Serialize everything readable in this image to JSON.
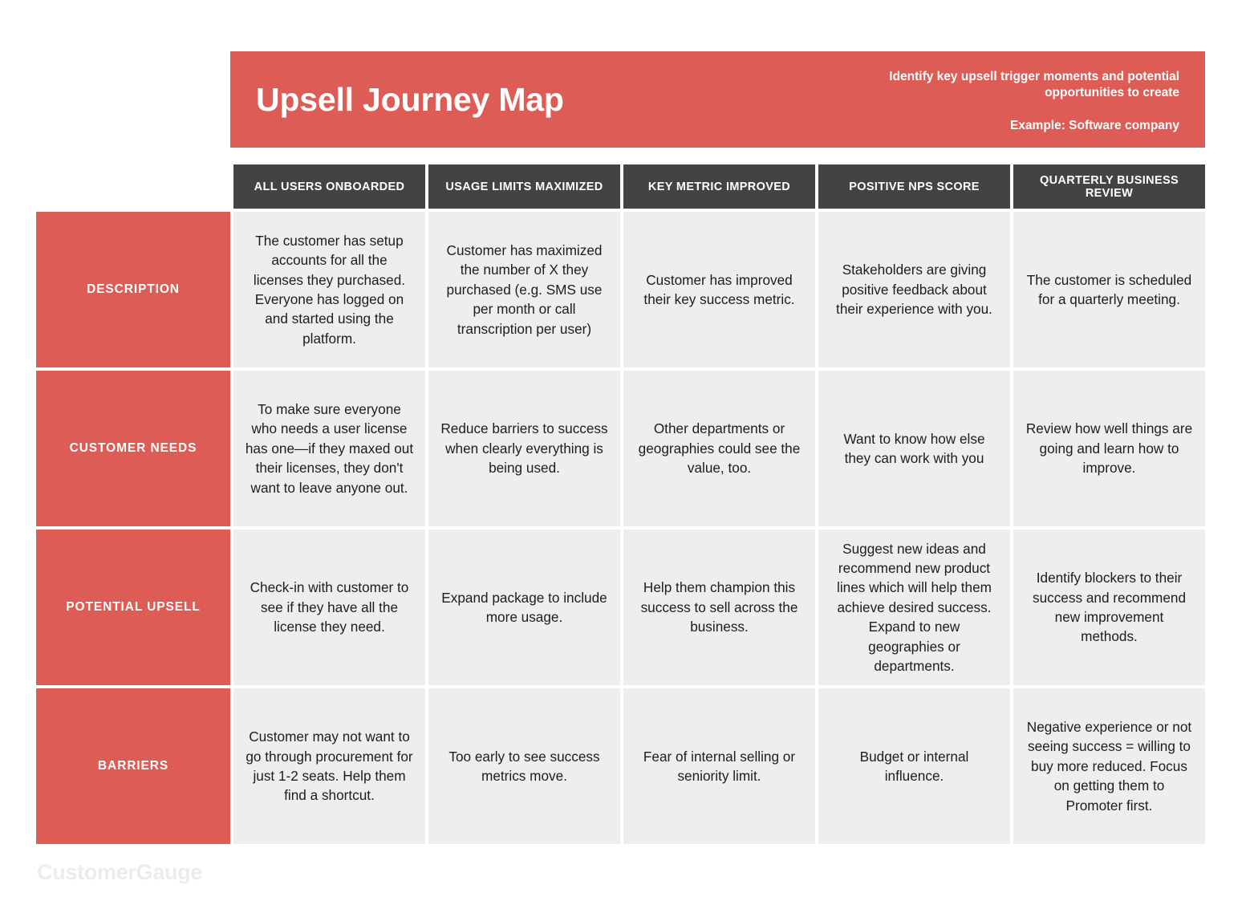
{
  "header": {
    "title": "Upsell Journey Map",
    "subtitle": "Identify key upsell trigger moments and potential opportunities to create",
    "example": "Example: Software company",
    "accent_color": "#DD5C55",
    "header_cell_color": "#434343",
    "cell_color": "#eeeeee"
  },
  "footer": {
    "logo": "CustomerGauge",
    "logo_color": "#ececec"
  },
  "table": {
    "columns": [
      "ALL USERS ONBOARDED",
      "USAGE LIMITS MAXIMIZED",
      "KEY METRIC IMPROVED",
      "POSITIVE NPS SCORE",
      "QUARTERLY BUSINESS REVIEW"
    ],
    "rows": [
      {
        "label": "DESCRIPTION",
        "cells": [
          "The customer has setup accounts for all the licenses they purchased. Everyone has logged on and started using the platform.",
          "Customer has maximized the number of X they purchased (e.g. SMS use per month or call transcription per user)",
          "Customer has improved their key success metric.",
          "Stakeholders are giving positive feedback about their experience with you.",
          "The customer is scheduled for a quarterly meeting."
        ]
      },
      {
        "label": "CUSTOMER NEEDS",
        "cells": [
          "To make sure everyone who needs a user license has one—if they maxed out their licenses, they don't want to leave anyone out.",
          "Reduce barriers to success when clearly everything is being used.",
          "Other departments or geographies could see the value, too.",
          "Want to know how else they can work with you",
          "Review how well things are going and learn how to improve."
        ]
      },
      {
        "label": "POTENTIAL UPSELL",
        "cells": [
          "Check-in with customer to see if they have all the license they need.",
          "Expand package to include more usage.",
          "Help them champion this success to sell across the business.",
          "Suggest new ideas and recommend new product lines which will help them achieve desired success. Expand to new geographies or departments.",
          "Identify blockers to their success and recommend new improvement methods."
        ]
      },
      {
        "label": "BARRIERS",
        "cells": [
          "Customer may not want to go through procurement for just 1-2 seats. Help them find a shortcut.",
          "Too early to see success metrics move.",
          "Fear of internal selling or seniority limit.",
          "Budget or internal influence.",
          "Negative experience or not seeing success = willing to buy more reduced. Focus on getting them to Promoter first."
        ]
      }
    ]
  }
}
